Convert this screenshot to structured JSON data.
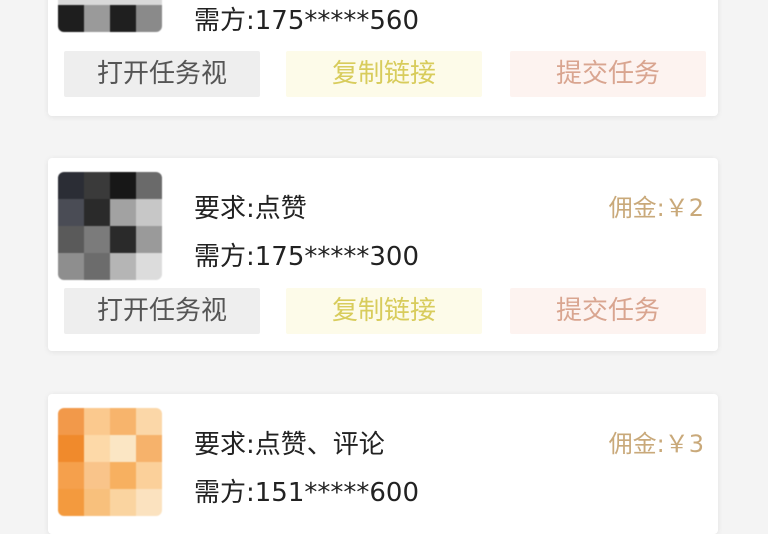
{
  "tasks": [
    {
      "owner": "需方:175*****560",
      "actions": {
        "open": "打开任务视",
        "copy": "复制链接",
        "submit": "提交任务"
      },
      "avatar_colors": [
        "#d9d9d9",
        "#d9d9d9",
        "#d9d9d9",
        "#d9d9d9",
        "#d9d9d9",
        "#d9d9d9",
        "#d9d9d9",
        "#d9d9d9",
        "#d9d9d9",
        "#d9d9d9",
        "#d9d9d9",
        "#d9d9d9",
        "#1e1e1e",
        "#9a9a9a",
        "#1f1f1f",
        "#8a8a8a"
      ]
    },
    {
      "requirement": "要求:点赞",
      "fee": "佣金:￥2",
      "owner": "需方:175*****300",
      "actions": {
        "open": "打开任务视",
        "copy": "复制链接",
        "submit": "提交任务"
      },
      "avatar_colors": [
        "#2b2d35",
        "#3a3a3a",
        "#171717",
        "#6a6a6a",
        "#4a4c55",
        "#2a2a2a",
        "#a2a2a2",
        "#c7c7c7",
        "#5a5a5a",
        "#7b7b7b",
        "#2a2a2a",
        "#9a9a9a",
        "#8e8e8e",
        "#6c6c6c",
        "#b5b5b5",
        "#dcdcdc"
      ]
    },
    {
      "requirement": "要求:点赞、评论",
      "fee": "佣金:￥3",
      "owner": "需方:151*****600",
      "avatar_colors": [
        "#f2994a",
        "#fbc98e",
        "#f7b46c",
        "#fbd7a8",
        "#f08a2c",
        "#fdd9a8",
        "#fbe6c4",
        "#f6b26b",
        "#f5a04c",
        "#f9c48a",
        "#f7b060",
        "#fbd09a",
        "#f39a3e",
        "#f8c07c",
        "#fad4a0",
        "#fbe2bf"
      ]
    }
  ]
}
